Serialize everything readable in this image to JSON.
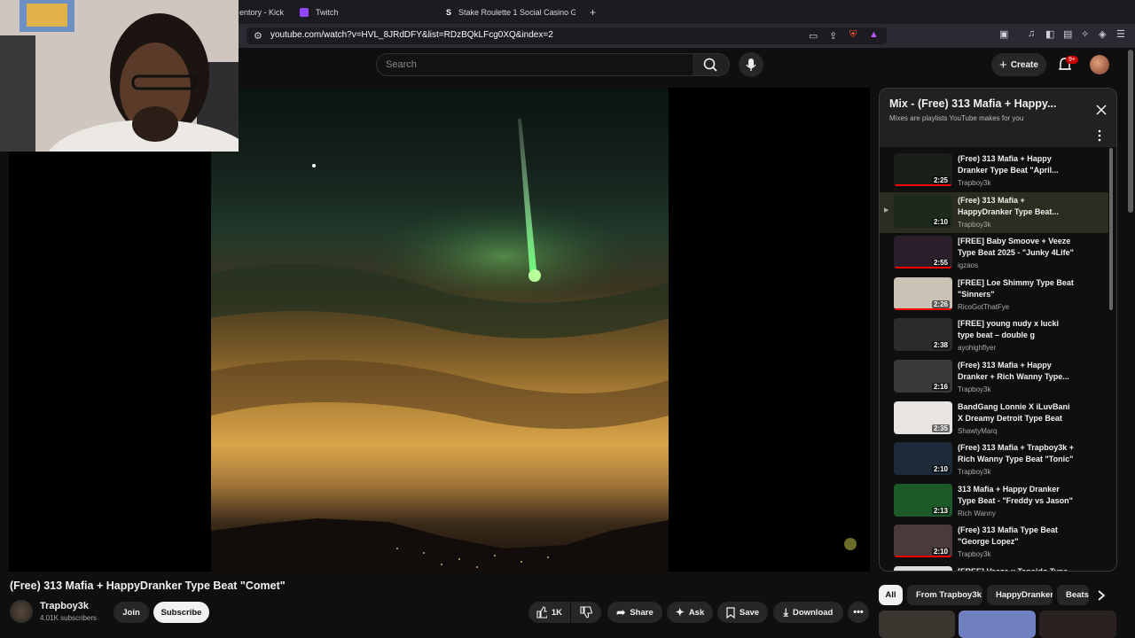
{
  "browser": {
    "tabs": [
      {
        "label": "entory - Kick"
      },
      {
        "label": "Twitch"
      },
      {
        "label": "Stake Roulette 1 Social Casino Gar"
      }
    ],
    "new_tab": "+",
    "url": "youtube.com/watch?v=HVL_8JRdDFY&list=RDzBQkLFcg0XQ&index=2"
  },
  "header": {
    "search_placeholder": "Search",
    "create_label": "Create",
    "notification_count": "9+"
  },
  "video": {
    "title": "(Free) 313 Mafia + HappyDranker Type Beat \"Comet\"",
    "channel": "Trapboy3k",
    "subscribers": "4.01K subscribers",
    "join_label": "Join",
    "subscribe_label": "Subscribe",
    "like_count": "1K",
    "share_label": "Share",
    "ask_label": "Ask",
    "save_label": "Save",
    "download_label": "Download"
  },
  "playlist": {
    "title": "Mix - (Free) 313 Mafia + Happy...",
    "subtitle": "Mixes are playlists YouTube makes for you",
    "items": [
      {
        "title": "(Free) 313 Mafia + Happy Dranker Type Beat \"April...",
        "channel": "Trapboy3k",
        "duration": "2:25",
        "watched": 1.0
      },
      {
        "title": "(Free) 313 Mafia + HappyDranker Type Beat...",
        "channel": "Trapboy3k",
        "duration": "2:10",
        "active": true
      },
      {
        "title": "[FREE] Baby Smoove + Veeze Type Beat 2025 - \"Junky 4Life\"",
        "channel": "igzaos",
        "duration": "2:55",
        "watched": 1.0
      },
      {
        "title": "[FREE] Loe Shimmy Type Beat \"Sinners\"",
        "channel": "RicoGotThatFye",
        "duration": "2:26",
        "watched": 1.0
      },
      {
        "title": "[FREE] young nudy x lucki type beat – double g",
        "channel": "ayohighflyer",
        "duration": "2:38"
      },
      {
        "title": "(Free) 313 Mafia + Happy Dranker + Rich Wanny Type...",
        "channel": "Trapboy3k",
        "duration": "2:16"
      },
      {
        "title": "BandGang Lonnie X iLuvBani X Dreamy Detroit Type Beat 202...",
        "channel": "ShawtyMarq",
        "duration": "2:35"
      },
      {
        "title": "(Free) 313 Mafia + Trapboy3k + Rich Wanny Type Beat \"Tonic\"",
        "channel": "Trapboy3k",
        "duration": "2:10"
      },
      {
        "title": "313 Mafia + Happy Dranker Type Beat - \"Freddy vs Jason\"",
        "channel": "Rich Wanny",
        "duration": "2:13"
      },
      {
        "title": "(Free) 313 Mafia Type Beat \"George Lopez\"",
        "channel": "Trapboy3k",
        "duration": "2:10",
        "watched": 1.0
      },
      {
        "title": "[FREE] Veeze x Tanaido Type...",
        "channel": "",
        "duration": ""
      }
    ]
  },
  "chips": [
    {
      "label": "All"
    },
    {
      "label": "From Trapboy3k"
    },
    {
      "label": "HappyDranker"
    },
    {
      "label": "Beats"
    }
  ],
  "icons": {
    "colors": {
      "accent_red": "#ff0000",
      "chip_active": "#f1f1f1",
      "badge": "#cc0000"
    }
  }
}
